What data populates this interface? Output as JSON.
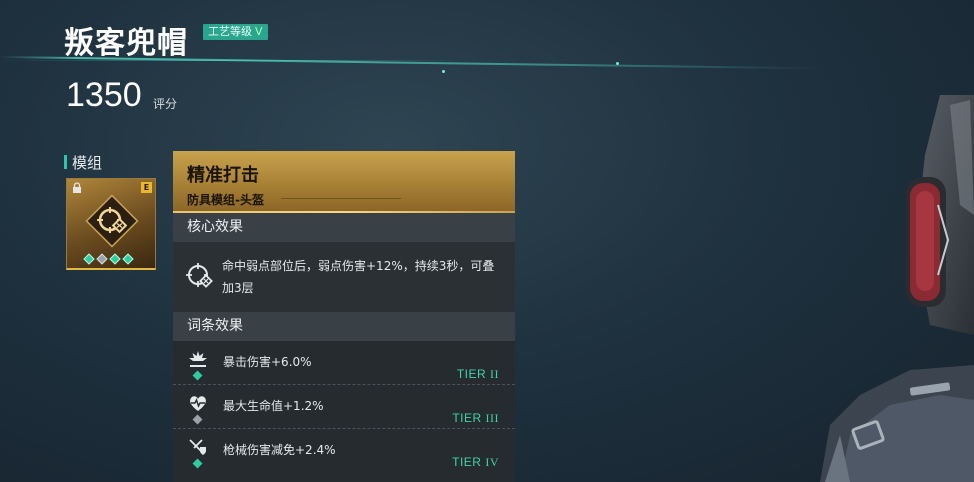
{
  "item": {
    "name": "叛客兜帽",
    "craft_label": "工艺等级",
    "craft_level": "V",
    "score": "1350",
    "score_label": "评分"
  },
  "modules_section": {
    "title": "模组",
    "card": {
      "grade": "E",
      "icon": "crosshair-emblem-icon",
      "gems": [
        "teal",
        "grey",
        "teal",
        "teal"
      ]
    }
  },
  "detail_panel": {
    "name": "精准打击",
    "subtitle": "防具模组-头盔",
    "core_header": "核心效果",
    "core_effect": "命中弱点部位后，弱点伤害+12%，持续3秒，可叠加3层",
    "affix_header": "词条效果",
    "affixes": [
      {
        "text": "暴击伤害+6.0%",
        "tier_label": "TIER",
        "tier_roman": "II",
        "icon": "explosion-icon",
        "gem": "teal"
      },
      {
        "text": "最大生命值+1.2%",
        "tier_label": "TIER",
        "tier_roman": "III",
        "icon": "heart-pulse-icon",
        "gem": "grey"
      },
      {
        "text": "枪械伤害减免+2.4%",
        "tier_label": "TIER",
        "tier_roman": "IV",
        "icon": "gun-shield-icon",
        "gem": "teal"
      }
    ]
  },
  "colors": {
    "accent": "#2ec4a8",
    "tier": "#3fd4a8",
    "gold": "#c9a24e"
  }
}
